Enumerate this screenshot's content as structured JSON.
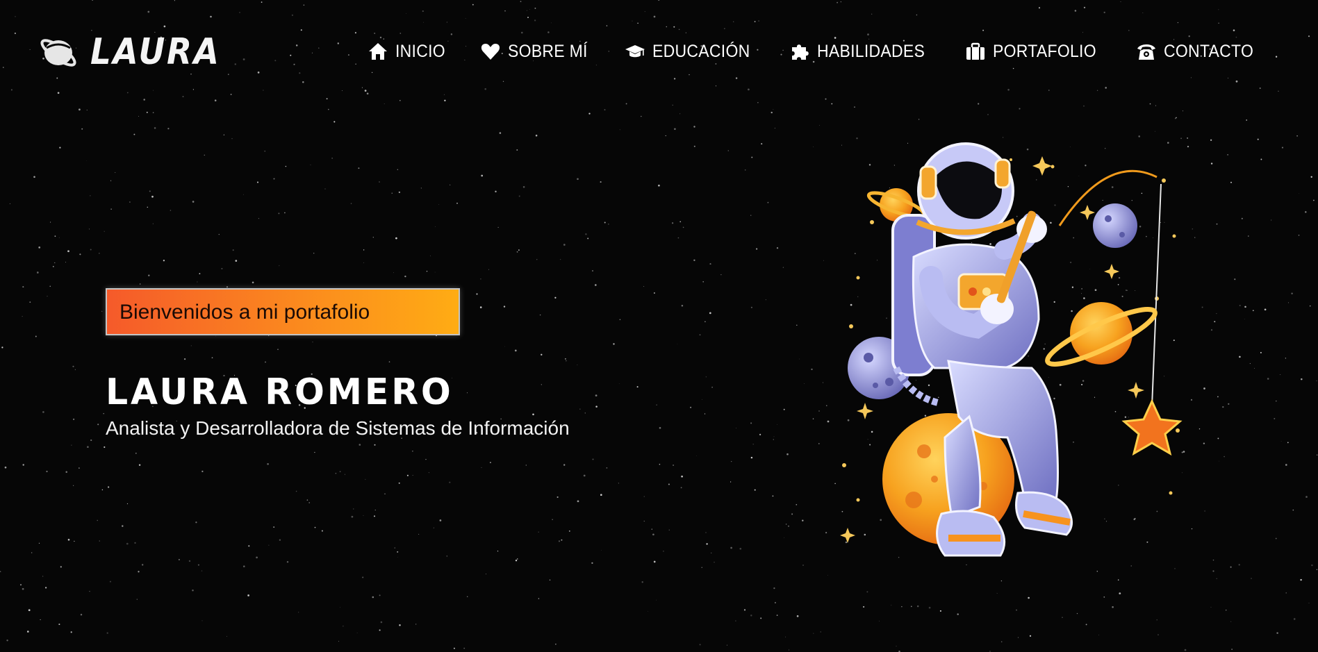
{
  "logo": {
    "text": "LAURA",
    "icon": "planet-icon"
  },
  "nav": {
    "items": [
      {
        "label": "INICIO",
        "icon": "home-icon"
      },
      {
        "label": "SOBRE MÍ",
        "icon": "heart-icon"
      },
      {
        "label": "EDUCACIÓN",
        "icon": "graduation-cap-icon"
      },
      {
        "label": "HABILIDADES",
        "icon": "puzzle-icon"
      },
      {
        "label": "PORTAFOLIO",
        "icon": "briefcase-icon"
      },
      {
        "label": "CONTACTO",
        "icon": "phone-icon"
      }
    ]
  },
  "hero": {
    "welcome": "Bienvenidos a mi portafolio",
    "name": "LAURA ROMERO",
    "role": "Analista y Desarrolladora de Sistemas de Información"
  },
  "illustration": {
    "subject": "astronaut-on-planet"
  },
  "colors": {
    "background": "#060606",
    "accent_start": "#f55a2a",
    "accent_end": "#ffac14",
    "suit": "#8f8fd6",
    "planet_orange": "#f7a21f"
  }
}
